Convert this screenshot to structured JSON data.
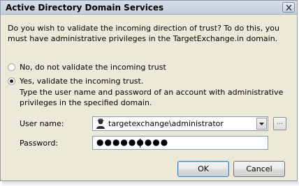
{
  "window": {
    "title": "Active Directory Domain Services"
  },
  "question": "Do you wish to validate the incoming direction of trust? To do this, you must have administrative privileges in the TargetExchange.in domain.",
  "options": [
    {
      "label": "No, do not validate the incoming trust",
      "selected": false
    },
    {
      "label": "Yes, validate the incoming trust.",
      "selected": true
    }
  ],
  "hint": "Type the user name and password of an account with administrative privileges in the specified domain.",
  "username": {
    "label": "User name:",
    "value": "targetexchange\\administrator",
    "icon": "user-icon"
  },
  "browse_label": "...",
  "password": {
    "label": "Password:",
    "masked_value": "●●●●●●●●●"
  },
  "buttons": {
    "ok": "OK",
    "cancel": "Cancel"
  }
}
